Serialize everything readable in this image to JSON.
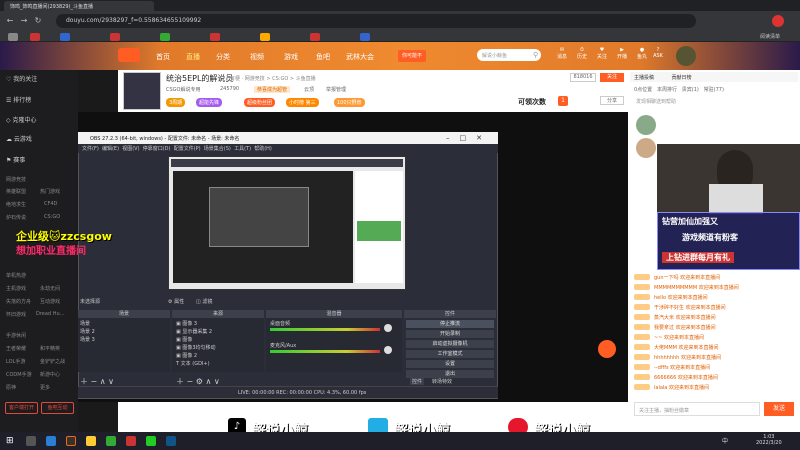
{
  "browser": {
    "tab_title": "饰鸣_饰鸣直播间(293829)_斗鱼直播",
    "url": "douyu.com/2938297_f=0.558634655109992",
    "profile_label": "阅读清单"
  },
  "douyu": {
    "nav": [
      "首页",
      "直播",
      "分类",
      "视频",
      "游戏",
      "鱼吧",
      "武林大会"
    ],
    "promo_btn": "你可能不",
    "search_placeholder": "解说小鲸鱼",
    "icons": [
      "消息",
      "历史",
      "关注",
      "开播",
      "鱼丸",
      "ASK"
    ]
  },
  "sidebar": {
    "items": [
      "我的关注",
      "排行榜",
      "克隆中心",
      "云游戏",
      "赛事"
    ],
    "section1": "网游竞技",
    "sub1": [
      "英雄联盟",
      "热门游戏",
      "绝地求生",
      "CF4D",
      "炉石传说",
      "CS:GO",
      "王者荣耀",
      "和平精英"
    ],
    "section2": "单机热游",
    "sub2": [
      "主机游戏",
      "永劫无间",
      "失落的方舟",
      "互动游戏",
      "怀旧游戏",
      "Dread Hu..."
    ],
    "section3": "手游休闲",
    "sub3": [
      "王者荣耀",
      "和平精英",
      "LOL手游",
      "金铲铲之战",
      "CODM手游",
      "新游中心",
      "原神",
      "更多"
    ],
    "btn_left": "客户端打开",
    "btn_right": "鱼吧互动"
  },
  "room": {
    "title": "统治5EPL的解说员",
    "sub": "有梗 · 网游竞技 > CS:GO > 斗鱼直播",
    "meta": [
      "CSGO解说专用",
      "245790",
      "恭喜成为超管",
      "云顶",
      "举报管理",
      "关注"
    ],
    "tags": [
      "3周期",
      "超能先锋",
      "超级粉丝团",
      "小时榜 第三",
      "100只野兽"
    ],
    "follow_label": "可领次数",
    "count": "1",
    "right_btns": [
      "818016",
      "关注",
      "分享"
    ]
  },
  "obs": {
    "title": "OBS 27.2.3 (64-bit, windows) - 配置文件: 未命名 - 场景: 未命名",
    "menu": [
      "文件(F)",
      "编辑(E)",
      "视图(V)",
      "停靠窗口(D)",
      "配置文件(P)",
      "场景集合(S)",
      "工具(T)",
      "帮助(H)"
    ],
    "no_source": "未选择源",
    "properties": "属性",
    "filters": "滤镜",
    "scene_hdr": "场景",
    "source_hdr": "来源",
    "mixer_hdr": "混音器",
    "controls_hdr": "控件",
    "scenes": [
      "场景",
      "场景 2",
      "场景 3"
    ],
    "sources": [
      "图像 3",
      "显示器采集 2",
      "图像",
      "图像3均匀移动",
      "图像 2",
      "文本 (GDI+)"
    ],
    "mixer": [
      "桌面音频",
      "麦克风/Aux"
    ],
    "controls": [
      "停止推流",
      "开始录制",
      "启动虚拟摄像机",
      "工作室模式",
      "设置",
      "退出"
    ],
    "status": "LIVE: 00:00:00   REC: 00:00:00   CPU: 4.3%, 60.00 fps",
    "tabs": [
      "控件",
      "转场特效"
    ]
  },
  "overlay": {
    "promo_line1": "企业级🐱zzcsgow",
    "promo_line2": "想加职业直播间"
  },
  "chat": {
    "tabs": [
      "主播投稿",
      "贡献日榜"
    ],
    "subtabs": [
      "0点位置",
      "本周排行",
      "贵宾(1)",
      "常驻(77)"
    ],
    "notice": "发现相聊送到帮助",
    "lines": [
      "gun一下吗 欢迎来到本直播间",
      "MMMMMMMMMM 欢迎来到本直播间",
      "hello 欢迎来到本直播间",
      "干涉碎不好生 欢迎来到本直播间",
      "蒸汽大米 欢迎来到本直播间",
      "我要拿过 欢迎来到本直播间",
      "~~ 欢迎来到本直播间",
      "大佬MMM 欢迎来到本直播间",
      "hhhhhhhh 欢迎来到本直播间",
      "--dfffs 欢迎来到本直播间",
      "6666666 欢迎来到本直播间",
      "lalala 欢迎来到本直播间"
    ],
    "input_placeholder": "关注主播，抽粉丝徽章",
    "send": "发送",
    "cam_ad": [
      "钻营加仙加强又",
      "游戏频道有粉客",
      "上钻进群每月有礼"
    ]
  },
  "bottom": {
    "brands": [
      "解说小鲸",
      "解说小鲸",
      "解说小鲸"
    ]
  },
  "taskbar": {
    "time": "1:03",
    "date": "2022/3/20",
    "lang": "中"
  }
}
